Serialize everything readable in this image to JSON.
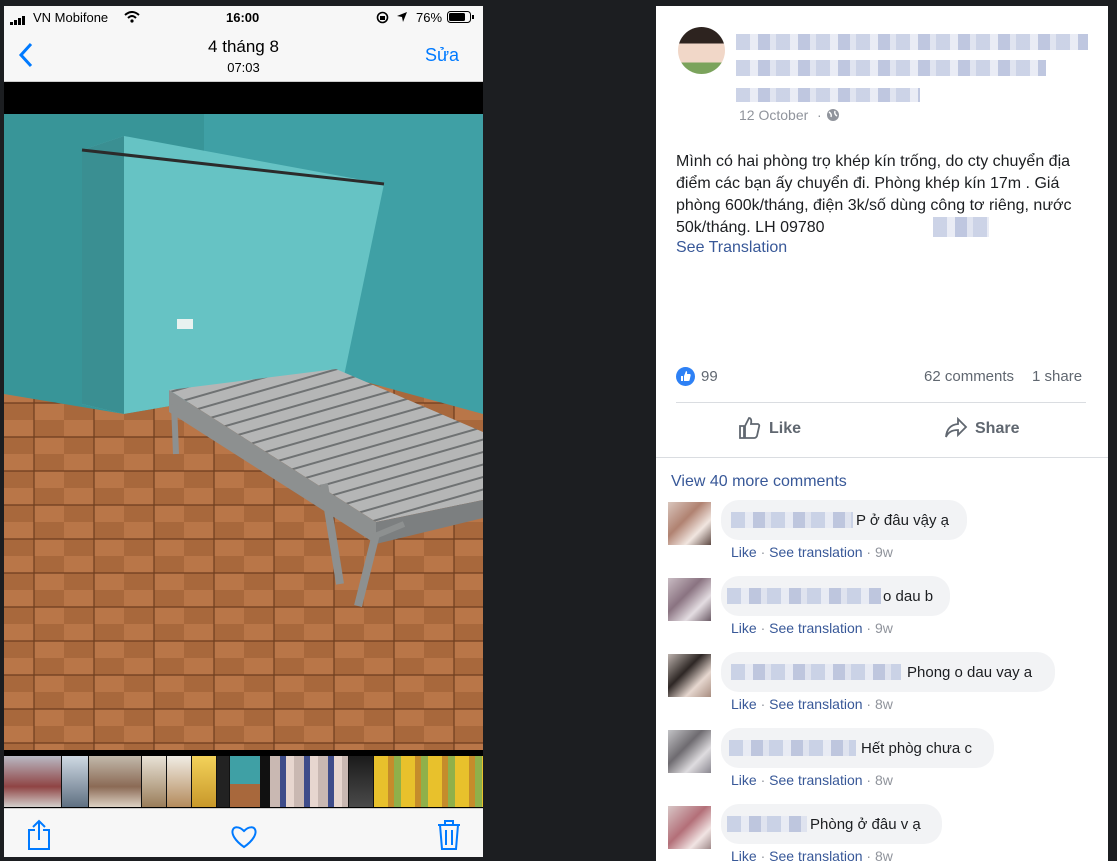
{
  "phone": {
    "status": {
      "carrier": "VN Mobifone",
      "time": "16:00",
      "battery": "76%"
    },
    "nav": {
      "back_icon": "chevron-left-icon",
      "title": "4 tháng 8",
      "subtitle": "07:03",
      "edit_label": "Sửa"
    },
    "toolbar": {
      "share_icon": "share-icon",
      "like_icon": "heart-icon",
      "delete_icon": "trash-icon"
    }
  },
  "post": {
    "date": "12 October",
    "body": "Mình có hai phòng trọ khép kín trống, do cty chuyển địa điểm các bạn ấy chuyển đi. Phòng khép kín 17m . Giá phòng 600k/tháng, điện 3k/số dùng công tơ riêng, nước 50k/tháng. LH 09780",
    "see_translation": "See Translation",
    "reaction_count": "99",
    "comments_count": "62 comments",
    "shares_count": "1 share",
    "like_label": "Like",
    "share_label": "Share",
    "view_more": "View 40 more comments",
    "comment_like": "Like",
    "comment_translate": "See translation",
    "comments": [
      {
        "text": "P ở đâu vậy ạ",
        "age": "9w"
      },
      {
        "text": "o dau b",
        "age": "9w"
      },
      {
        "text": "Phong o dau vay a",
        "age": "8w"
      },
      {
        "text": "Hết phòg chưa c",
        "age": "8w"
      },
      {
        "text": "Phòng ở đâu v ạ",
        "age": "8w"
      }
    ]
  },
  "colors": {
    "fb_blue": "#385898",
    "ios_blue": "#007aff",
    "wall": "#3f9fa3",
    "floor": "#a0633a"
  }
}
